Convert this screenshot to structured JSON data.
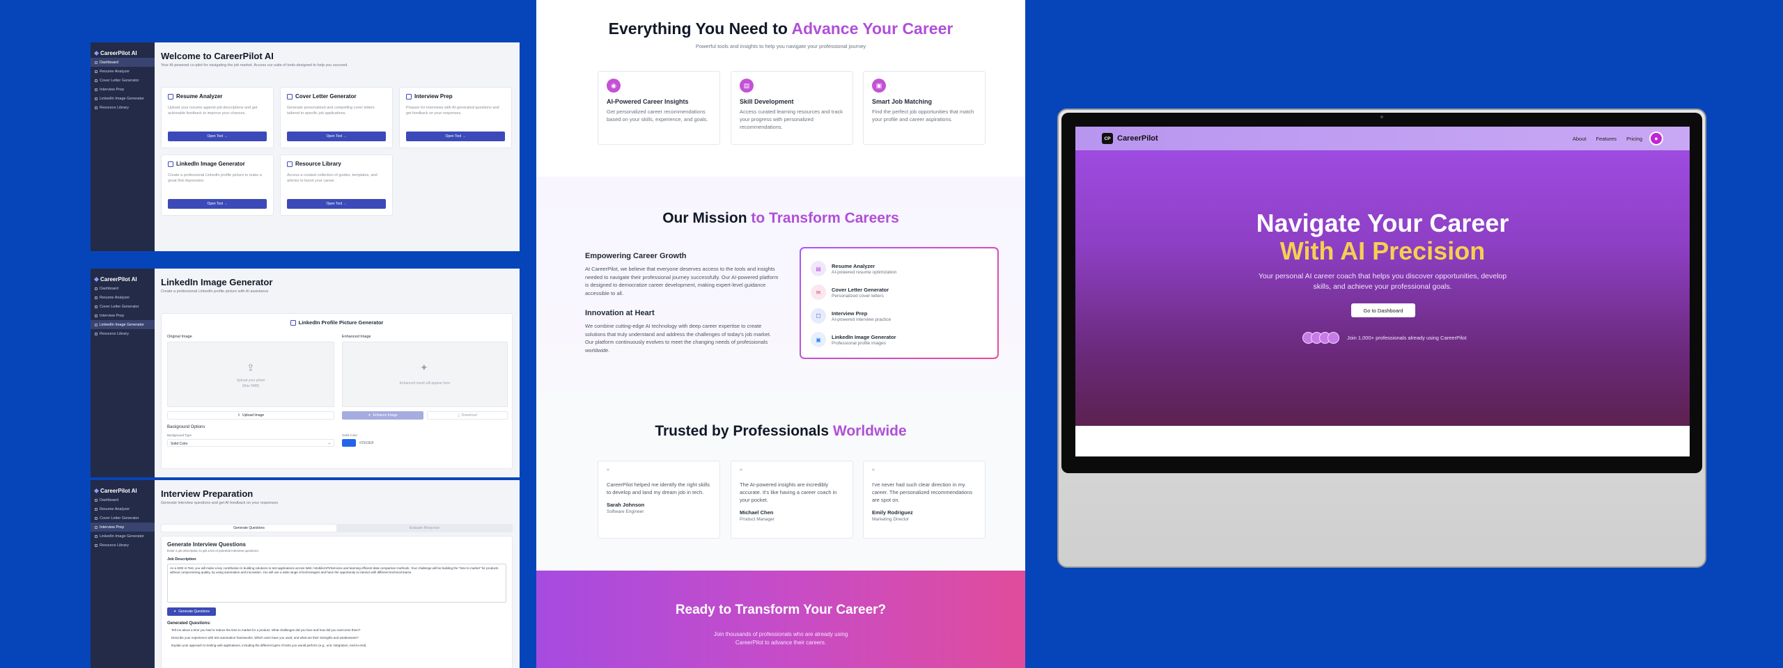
{
  "shot1": {
    "brand": "CareerPilot AI",
    "nav": [
      "Dashboard",
      "Resume Analyzer",
      "Cover Letter Generator",
      "Interview Prep",
      "LinkedIn Image Generator",
      "Resource Library"
    ],
    "title": "Welcome to CareerPilot AI",
    "subtitle": "Your AI-powered co-pilot for navigating the job market. Access our suite of tools designed to help you succeed.",
    "cards": [
      {
        "title": "Resume Analyzer",
        "desc": "Upload your resume against job descriptions and get actionable feedback to improve your chances."
      },
      {
        "title": "Cover Letter Generator",
        "desc": "Generate personalized and compelling cover letters tailored to specific job applications."
      },
      {
        "title": "Interview Prep",
        "desc": "Prepare for interviews with AI-generated questions and get feedback on your responses."
      },
      {
        "title": "LinkedIn Image Generator",
        "desc": "Create a professional LinkedIn profile picture to make a great first impression."
      },
      {
        "title": "Resource Library",
        "desc": "Access a curated collection of guides, templates, and articles to boost your career."
      }
    ],
    "open": "Open Tool →"
  },
  "shot2": {
    "title": "LinkedIn Image Generator",
    "subtitle": "Create a professional LinkedIn profile picture with AI assistance",
    "panel_title": "LinkedIn Profile Picture Generator",
    "original": "Original Image",
    "enhanced": "Enhanced Image",
    "upload_hint": "Upload your photo",
    "upload_hint2": "(Max 5MB)",
    "enhanced_hint": "Enhanced result will appear here",
    "upload_btn": "Upload Image",
    "enhance_btn": "Enhance Image",
    "download_btn": "Download",
    "bg_options": "Background Options",
    "bg_type": "Background Type",
    "bg_value": "Solid Color",
    "solid_color": "Solid Color",
    "color_value": "#2563EB"
  },
  "shot3": {
    "title": "Interview Preparation",
    "subtitle": "Generate interview questions and get AI feedback on your responses",
    "tab1": "Generate Questions",
    "tab2": "Evaluate Response",
    "panel_title": "Generate Interview Questions",
    "panel_sub": "Enter a job description to get a list of potential interview questions.",
    "jd_label": "Job Description",
    "jd_text": "As a SDE in Test, you will make a key contribution in building solutions to test applications across Web / Mobile/API/Services and learning efficient data comparison methods. Your challenge will be building the \"time to market\" for products without compromising quality, by using automation and innovation. You will use a wide range of technologies and have the opportunity to interact with different technical teams.",
    "gen_btn": "Generate Questions",
    "gen_title": "Generated Questions:",
    "questions": [
      "Tell me about a time you had to reduce the time to market for a product. What challenges did you face and how did you overcome them?",
      "Describe your experience with test automation frameworks. Which ones have you used, and what are their strengths and weaknesses?",
      "Explain your approach to testing web applications, including the different types of tests you would perform (e.g., unit, integration, end-to-end)."
    ]
  },
  "landing": {
    "h_plain": "Everything You Need to",
    "h_accent": "Advance Your Career",
    "h_sub": "Powerful tools and insights to help you navigate your professional journey",
    "features": [
      {
        "title": "AI-Powered Career Insights",
        "desc": "Get personalized career recommendations based on your skills, experience, and goals."
      },
      {
        "title": "Skill Development",
        "desc": "Access curated learning resources and track your progress with personalized recommendations."
      },
      {
        "title": "Smart Job Matching",
        "desc": "Find the perfect job opportunities that match your profile and career aspirations."
      }
    ],
    "m_plain": "Our Mission",
    "m_accent": "to Transform Careers",
    "m1_title": "Empowering Career Growth",
    "m1_text": "At CareerPilot, we believe that everyone deserves access to the tools and insights needed to navigate their professional journey successfully. Our AI-powered platform is designed to democratize career development, making expert-level guidance accessible to all.",
    "m2_title": "Innovation at Heart",
    "m2_text": "We combine cutting-edge AI technology with deep career expertise to create solutions that truly understand and address the challenges of today's job market. Our platform continuously evolves to meet the changing needs of professionals worldwide.",
    "tools": [
      {
        "title": "Resume Analyzer",
        "sub": "AI-powered resume optimization"
      },
      {
        "title": "Cover Letter Generator",
        "sub": "Personalized cover letters"
      },
      {
        "title": "Interview Prep",
        "sub": "AI-powered interview practice"
      },
      {
        "title": "LinkedIn Image Generator",
        "sub": "Professional profile images"
      }
    ],
    "t_plain": "Trusted by Professionals",
    "t_accent": "Worldwide",
    "testimonials": [
      {
        "quote": "CareerPilot helped me identify the right skills to develop and land my dream job in tech.",
        "name": "Sarah Johnson",
        "role": "Software Engineer"
      },
      {
        "quote": "The AI-powered insights are incredibly accurate. It's like having a career coach in your pocket.",
        "name": "Michael Chen",
        "role": "Product Manager"
      },
      {
        "quote": "I've never had such clear direction in my career. The personalized recommendations are spot on.",
        "name": "Emily Rodriguez",
        "role": "Marketing Director"
      }
    ],
    "cta_title": "Ready to Transform Your Career?",
    "cta_sub": "Join thousands of professionals who are already using CareerPilot to advance their careers.",
    "qmark": "“"
  },
  "hero": {
    "logo": "CP",
    "brand": "CareerPilot",
    "nav": [
      "About",
      "Features",
      "Pricing"
    ],
    "l1": "Navigate Your Career",
    "l2": "With AI Precision",
    "sub": "Your personal AI career coach that helps you discover opportunities, develop skills, and achieve your professional goals.",
    "cta": "Go to Dashboard",
    "join": "Join 1,000+ professionals already using CareerPilot"
  },
  "colors": {
    "bg": "#0645b9",
    "primary": "#3b4ab8",
    "accent": "#b04fd8",
    "gold": "#f6cf52"
  }
}
